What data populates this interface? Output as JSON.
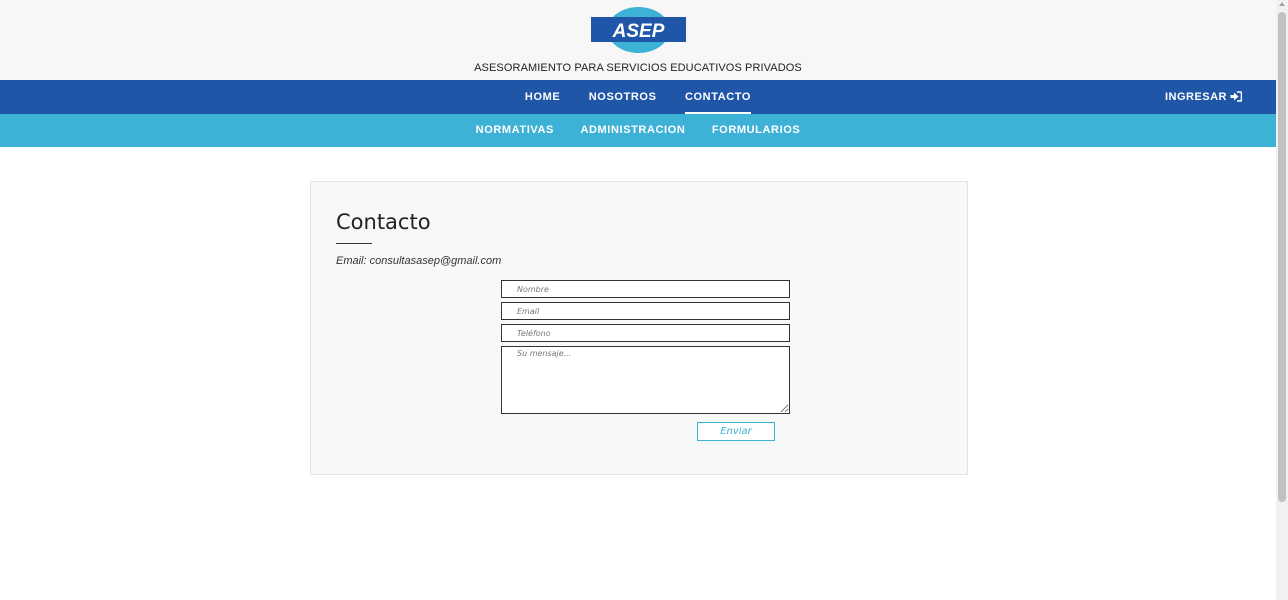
{
  "header": {
    "logo_text": "ASEP",
    "tagline": "ASESORAMIENTO PARA SERVICIOS EDUCATIVOS PRIVADOS"
  },
  "nav": {
    "main": [
      {
        "label": "HOME",
        "active": false
      },
      {
        "label": "NOSOTROS",
        "active": false
      },
      {
        "label": "CONTACTO",
        "active": true
      }
    ],
    "login_label": "INGRESAR",
    "sub": [
      {
        "label": "NORMATIVAS"
      },
      {
        "label": "ADMINISTRACION"
      },
      {
        "label": "FORMULARIOS"
      }
    ]
  },
  "contact": {
    "title": "Contacto",
    "email_line": "Email: consultasasep@gmail.com",
    "form": {
      "name_placeholder": "Nombre",
      "email_placeholder": "Email",
      "phone_placeholder": "Teléfono",
      "message_placeholder": "Su mensaje...",
      "submit_label": "Enviar"
    }
  },
  "colors": {
    "nav_main": "#1f56a8",
    "nav_sub": "#3db1d6",
    "logo_blue": "#1f56a8",
    "logo_light": "#3db1d6"
  },
  "icons": [
    "sign-in-icon"
  ]
}
